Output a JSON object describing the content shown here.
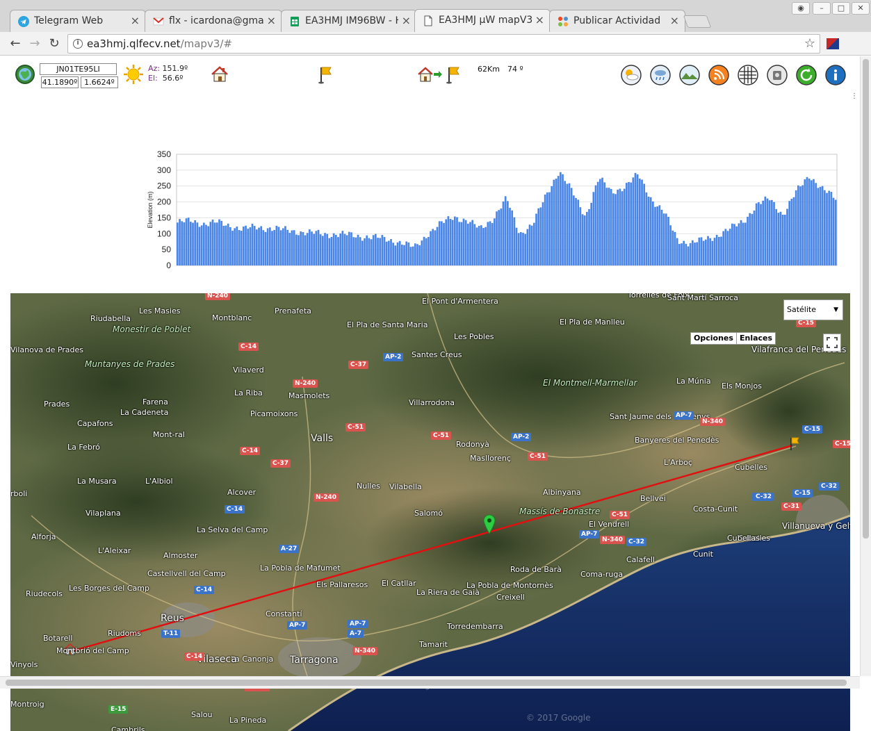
{
  "tabs": [
    {
      "label": "Telegram Web",
      "icon": "telegram-icon",
      "active": false
    },
    {
      "label": "flx - icardona@gmail",
      "icon": "gmail-icon",
      "active": false
    },
    {
      "label": "EA3HMJ IM96BW - H",
      "icon": "sheets-icon",
      "active": false
    },
    {
      "label": "EA3HMJ µW mapV3",
      "icon": "document-icon",
      "active": true
    },
    {
      "label": "Publicar Actividad",
      "icon": "joomla-icon",
      "active": false
    }
  ],
  "address": {
    "host": "ea3hmj.qlfecv.net",
    "path": "/mapv3/#"
  },
  "station": {
    "locator": "JN01TE95LI",
    "lat": "41.1890º",
    "lon": "1.6624º"
  },
  "sun": {
    "az_label": "Az:",
    "az": "151.9º",
    "el_label": "El:",
    "el": "56.6º"
  },
  "path": {
    "distance": "62Km",
    "bearing": "74 º"
  },
  "tools": [
    "weather-icon",
    "rain-icon",
    "terrain-icon",
    "rss-icon",
    "grid-icon",
    "camera-icon",
    "refresh-icon",
    "info-icon"
  ],
  "chart_data": {
    "type": "area",
    "ylabel": "Elevation (m)",
    "ylim": [
      0,
      350
    ],
    "yticks": [
      0,
      50,
      100,
      150,
      200,
      250,
      300,
      350
    ],
    "color": "#4a86e8",
    "x": [
      0,
      2,
      4,
      6,
      8,
      10,
      12,
      14,
      16,
      18,
      20,
      22,
      24,
      26,
      28,
      30,
      32,
      34,
      36,
      38,
      40,
      42,
      44,
      46,
      48,
      50,
      52,
      54,
      56,
      58,
      60,
      62,
      64,
      66,
      68,
      70,
      72,
      74,
      76,
      78,
      80,
      82,
      84,
      86,
      88,
      90,
      92,
      94,
      96,
      98,
      100
    ],
    "values": [
      135,
      140,
      132,
      135,
      125,
      115,
      120,
      118,
      112,
      108,
      102,
      100,
      98,
      96,
      92,
      88,
      82,
      72,
      55,
      100,
      130,
      155,
      140,
      115,
      150,
      210,
      100,
      130,
      220,
      300,
      230,
      155,
      275,
      230,
      250,
      285,
      210,
      165,
      80,
      70,
      80,
      95,
      115,
      140,
      190,
      210,
      160,
      230,
      285,
      240,
      210
    ],
    "point_count": 300
  },
  "map": {
    "type_label": "Satélite",
    "options_label": "Opciones",
    "links_label": "Enlaces",
    "copyright": "© 2017 Google",
    "labels": [
      {
        "text": "Riudabella"
      },
      {
        "text": "Les Masies"
      },
      {
        "text": "Montblanc"
      },
      {
        "text": "Prenafeta"
      },
      {
        "text": "El Pont d'Armentera"
      },
      {
        "text": "El Pla de Santa Maria"
      },
      {
        "text": "Les Pobles"
      },
      {
        "text": "Santes Creus"
      },
      {
        "text": "Torrelles de Foix"
      },
      {
        "text": "Sant Martí Sarroca"
      },
      {
        "text": "El Pla de Manlleu"
      },
      {
        "text": "Monestir de Poblet"
      },
      {
        "text": "Vilanova de Prades"
      },
      {
        "text": "Muntanyes de Prades"
      },
      {
        "text": "Vilaverd"
      },
      {
        "text": "Vilafranca del Penedès"
      },
      {
        "text": "Prades"
      },
      {
        "text": "Farena"
      },
      {
        "text": "La Cadeneta"
      },
      {
        "text": "La Riba"
      },
      {
        "text": "Masmolets"
      },
      {
        "text": "Villarrodona"
      },
      {
        "text": "El Montmell-Marmellar"
      },
      {
        "text": "La Múnia"
      },
      {
        "text": "Els Monjos"
      },
      {
        "text": "Capafons"
      },
      {
        "text": "Picamoixons"
      },
      {
        "text": "Sant Jaume dels Domenys"
      },
      {
        "text": "Mont-ral"
      },
      {
        "text": "Valls"
      },
      {
        "text": "Rodonyà"
      },
      {
        "text": "Banyeres del Penedès"
      },
      {
        "text": "La Febró"
      },
      {
        "text": "Masllorenç"
      },
      {
        "text": "L'Arboç"
      },
      {
        "text": "Cubelles"
      },
      {
        "text": "La Musara"
      },
      {
        "text": "L'Albiol"
      },
      {
        "text": "Alcover"
      },
      {
        "text": "Nulles"
      },
      {
        "text": "Vilabella"
      },
      {
        "text": "Albinyana"
      },
      {
        "text": "Bellvei"
      },
      {
        "text": "Vilaplana"
      },
      {
        "text": "Salomó"
      },
      {
        "text": "Massís de Bonastre"
      },
      {
        "text": "El Vendrell"
      },
      {
        "text": "Costa-Cunit"
      },
      {
        "text": "Alforja"
      },
      {
        "text": "La Selva del Camp"
      },
      {
        "text": "Villanueva y Geltrú"
      },
      {
        "text": "L'Aleixar"
      },
      {
        "text": "Almoster"
      },
      {
        "text": "Calafell"
      },
      {
        "text": "Cunit"
      },
      {
        "text": "Castellvell del Camp"
      },
      {
        "text": "La Pobla de Mafumet"
      },
      {
        "text": "Roda de Barà"
      },
      {
        "text": "Coma-ruga"
      },
      {
        "text": "Riudecols"
      },
      {
        "text": "Les Borges del Camp"
      },
      {
        "text": "Els Pallaresos"
      },
      {
        "text": "El Catllar"
      },
      {
        "text": "La Pobla de Montornès"
      },
      {
        "text": "Reus"
      },
      {
        "text": "Constantí"
      },
      {
        "text": "La Riera de Gaià"
      },
      {
        "text": "Creixell"
      },
      {
        "text": "Botarell"
      },
      {
        "text": "Riudoms"
      },
      {
        "text": "Torredembarra"
      },
      {
        "text": "Montbrió del Camp"
      },
      {
        "text": "La Canonja"
      },
      {
        "text": "Tamarit"
      },
      {
        "text": "Vilaseca"
      },
      {
        "text": "Tarragona"
      },
      {
        "text": "Montroig"
      },
      {
        "text": "Salou"
      },
      {
        "text": "La Pineda"
      },
      {
        "text": "Cambrils"
      },
      {
        "text": "Cubelles"
      },
      {
        "text": "Cubellas"
      },
      {
        "text": "rboli"
      },
      {
        "text": "Vinyols"
      }
    ],
    "roads": [
      {
        "text": "N-240",
        "c": "red"
      },
      {
        "text": "C-14",
        "c": "red"
      },
      {
        "text": "C-37",
        "c": "red"
      },
      {
        "text": "AP-2",
        "c": "blue"
      },
      {
        "text": "N-240",
        "c": "red"
      },
      {
        "text": "C-51",
        "c": "red"
      },
      {
        "text": "C-51",
        "c": "red"
      },
      {
        "text": "AP-2",
        "c": "blue"
      },
      {
        "text": "C-14",
        "c": "red"
      },
      {
        "text": "C-37",
        "c": "red"
      },
      {
        "text": "C-51",
        "c": "red"
      },
      {
        "text": "AP-7",
        "c": "blue"
      },
      {
        "text": "N-340",
        "c": "red"
      },
      {
        "text": "C-15",
        "c": "blue"
      },
      {
        "text": "C-15B",
        "c": "red"
      },
      {
        "text": "N-240",
        "c": "red"
      },
      {
        "text": "C-14",
        "c": "blue"
      },
      {
        "text": "C-51",
        "c": "red"
      },
      {
        "text": "C-32",
        "c": "blue"
      },
      {
        "text": "C-15",
        "c": "blue"
      },
      {
        "text": "C-32",
        "c": "blue"
      },
      {
        "text": "C-31",
        "c": "red"
      },
      {
        "text": "AP-7",
        "c": "blue"
      },
      {
        "text": "N-340",
        "c": "red"
      },
      {
        "text": "C-32",
        "c": "blue"
      },
      {
        "text": "A-27",
        "c": "blue"
      },
      {
        "text": "C-14",
        "c": "blue"
      },
      {
        "text": "AP-7",
        "c": "blue"
      },
      {
        "text": "AP-7",
        "c": "blue"
      },
      {
        "text": "A-7",
        "c": "blue"
      },
      {
        "text": "T-11",
        "c": "blue"
      },
      {
        "text": "N-340",
        "c": "red"
      },
      {
        "text": "C-14",
        "c": "red"
      },
      {
        "text": "C-31B",
        "c": "red"
      },
      {
        "text": "E-15",
        "c": "green"
      },
      {
        "text": "C-15",
        "c": "red"
      },
      {
        "text": "C-32",
        "c": "blue"
      }
    ]
  }
}
